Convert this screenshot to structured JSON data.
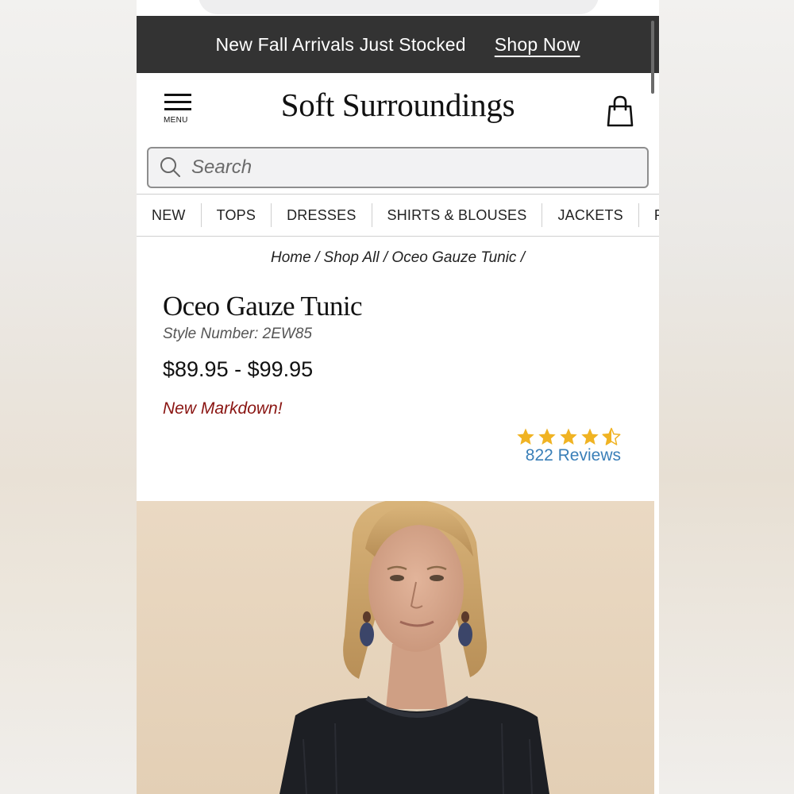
{
  "promo": {
    "message": "New Fall Arrivals Just Stocked",
    "cta": "Shop Now"
  },
  "header": {
    "menu_label": "MENU",
    "logo": "Soft Surroundings"
  },
  "search": {
    "placeholder": "Search"
  },
  "categories": [
    "NEW",
    "TOPS",
    "DRESSES",
    "SHIRTS & BLOUSES",
    "JACKETS",
    "PAN"
  ],
  "breadcrumb": [
    "Home",
    "Shop All",
    "Oceo Gauze Tunic"
  ],
  "product": {
    "title": "Oceo Gauze Tunic",
    "style_number": "Style Number: 2EW85",
    "price": "$89.95 - $99.95",
    "badge": "New Markdown!",
    "rating": 4.5,
    "reviews": "822 Reviews"
  },
  "colors": {
    "promo_bg": "#333333",
    "markdown": "#8a1512",
    "stars": "#f0b323",
    "reviews_link": "#3a7fb8"
  }
}
